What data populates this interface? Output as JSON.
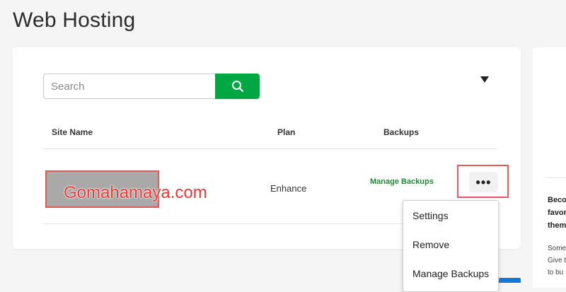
{
  "page": {
    "title": "Web Hosting"
  },
  "search": {
    "placeholder": "Search",
    "value": ""
  },
  "table": {
    "columns": [
      "Site Name",
      "Plan",
      "Backups"
    ],
    "rows": [
      {
        "site_name": "Gomahamaya.com",
        "plan": "Enhance",
        "backups_link": "Manage Backups"
      }
    ]
  },
  "menu": {
    "items": [
      "Settings",
      "Remove",
      "Manage Backups"
    ]
  },
  "side_panel": {
    "heading_lines": [
      "Beco",
      "favor",
      "them"
    ],
    "text_lines": [
      "Some",
      "Give t",
      "to bu"
    ]
  },
  "colors": {
    "accent_green": "#00a63f",
    "link_green": "#1f8a36",
    "highlight_red": "#e05a5a",
    "watermark_red": "#e53935"
  },
  "icons": {
    "search_button": "search-icon",
    "filter": "caret-down-icon",
    "more": "more-horizontal-icon"
  }
}
